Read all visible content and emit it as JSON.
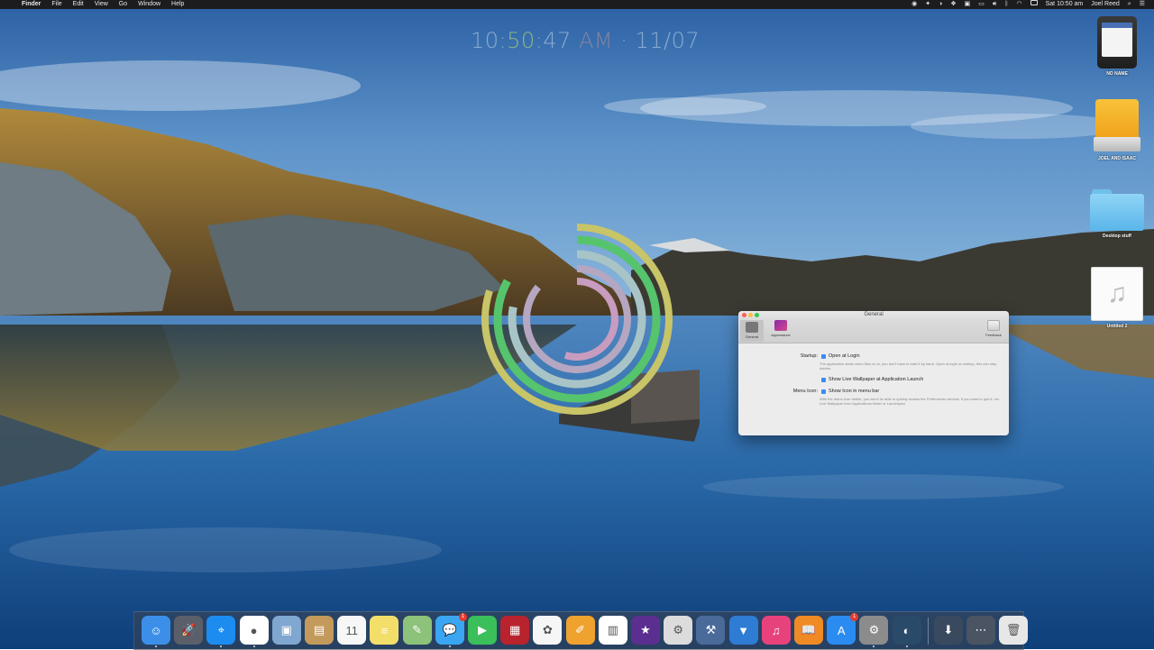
{
  "menubar": {
    "app_name": "Finder",
    "menus": [
      "File",
      "Edit",
      "View",
      "Go",
      "Window",
      "Help"
    ],
    "clock": "Sat 10:50 am",
    "user": "Joel Reed"
  },
  "clock_widget": {
    "hour": "10:",
    "minute": "50",
    "second": ":47",
    "ampm": "AM",
    "sep": " · ",
    "date": "11/07"
  },
  "desktop_icons": [
    {
      "label": "NO NAME",
      "icon": "external-disk-icon"
    },
    {
      "label": "JOEL AND ISAAC",
      "icon": "hard-drive-icon"
    },
    {
      "label": "Desktop stuff",
      "icon": "folder-icon"
    },
    {
      "label": "Untitled 2",
      "icon": "music-document-icon"
    }
  ],
  "pref_window": {
    "title": "General",
    "toolbar": [
      "General",
      "Appearance",
      "Feedback"
    ],
    "startup_label": "Startup:",
    "open_at_login": "Open at Login",
    "open_at_login_help": "The application starts when Mac is on, you don't have to start it by hand. Open at login on startup, this can stay hidden.",
    "show_live_wallpaper": "Show Live Wallpaper at Application Launch",
    "menu_icon_label": "Menu Icon:",
    "show_icon_menu_bar": "Show Icon in menu bar",
    "menu_icon_help": "With the menu icon visible, you won't be able to quickly access the Preferences window. If you want to quit it, run Live Wallpaper from Applications folder or Launchpad.",
    "checkbox_color": "#3b8bf5"
  },
  "dock": {
    "items": [
      {
        "name": "Finder",
        "icon": "finder-icon",
        "bg": "#3c8fe8",
        "glyph": "☺"
      },
      {
        "name": "Launchpad",
        "icon": "launchpad-icon",
        "bg": "#5a5f6a",
        "glyph": "🚀"
      },
      {
        "name": "Safari",
        "icon": "safari-icon",
        "bg": "#1d8cf0",
        "glyph": "⌖"
      },
      {
        "name": "Chrome",
        "icon": "chrome-icon",
        "bg": "#ffffff",
        "glyph": "●"
      },
      {
        "name": "Preview",
        "icon": "preview-icon",
        "bg": "#7fa7cf",
        "glyph": "▣"
      },
      {
        "name": "Contacts",
        "icon": "contacts-icon",
        "bg": "#c49a5c",
        "glyph": "▤"
      },
      {
        "name": "Calendar",
        "icon": "calendar-icon",
        "bg": "#f7f7f7",
        "glyph": "11"
      },
      {
        "name": "Notes",
        "icon": "notes-icon",
        "bg": "#f4de6a",
        "glyph": "≡"
      },
      {
        "name": "Maps",
        "icon": "maps-icon",
        "bg": "#8cc27a",
        "glyph": "✎"
      },
      {
        "name": "Messages",
        "icon": "messages-icon",
        "bg": "#3aa6f2",
        "glyph": "💬",
        "badge": "1"
      },
      {
        "name": "FaceTime",
        "icon": "facetime-icon",
        "bg": "#3bbf5b",
        "glyph": "▶"
      },
      {
        "name": "Photo Booth",
        "icon": "photo-booth-icon",
        "bg": "#b8232e",
        "glyph": "▦"
      },
      {
        "name": "Photos",
        "icon": "photos-icon",
        "bg": "#f6f6f6",
        "glyph": "✿"
      },
      {
        "name": "Pages",
        "icon": "pages-icon",
        "bg": "#f0a22e",
        "glyph": "✐"
      },
      {
        "name": "Numbers",
        "icon": "numbers-icon",
        "bg": "#ffffff",
        "glyph": "▥"
      },
      {
        "name": "iMovie",
        "icon": "imovie-icon",
        "bg": "#5b2f8f",
        "glyph": "★"
      },
      {
        "name": "Gatekeeper",
        "icon": "system-info-icon",
        "bg": "#dcdcdc",
        "glyph": "⚙"
      },
      {
        "name": "Xcode",
        "icon": "xcode-icon",
        "bg": "#4a6a9a",
        "glyph": "⚒"
      },
      {
        "name": "Keynote",
        "icon": "keynote-icon",
        "bg": "#2e7cd4",
        "glyph": "▼"
      },
      {
        "name": "iTunes",
        "icon": "itunes-icon",
        "bg": "#e8427c",
        "glyph": "♫"
      },
      {
        "name": "iBooks",
        "icon": "ibooks-icon",
        "bg": "#f08a24",
        "glyph": "📖"
      },
      {
        "name": "App Store",
        "icon": "app-store-icon",
        "bg": "#2a8cf0",
        "glyph": "A",
        "badge": "1"
      },
      {
        "name": "System Preferences",
        "icon": "system-preferences-icon",
        "bg": "#8c8c8c",
        "glyph": "⚙"
      },
      {
        "name": "Live Wallpaper",
        "icon": "live-wallpaper-icon",
        "bg": "#2a4a6a",
        "glyph": "◐"
      },
      {
        "name": "Downloads",
        "icon": "downloads-stack-icon",
        "bg": "#3a4a5e",
        "glyph": "⬇"
      },
      {
        "name": "Documents",
        "icon": "documents-stack-icon",
        "bg": "#4a5462",
        "glyph": "⋯"
      },
      {
        "name": "Trash",
        "icon": "trash-icon",
        "bg": "#e7e7e7",
        "glyph": "🗑"
      }
    ]
  },
  "ring_clock": {
    "rings": [
      {
        "name": "outer",
        "color": "#c8c468",
        "fraction": 0.8
      },
      {
        "name": "minutes",
        "color": "#56c46c",
        "fraction": 0.83
      },
      {
        "name": "seconds",
        "color": "#a8c4c6",
        "fraction": 0.78
      },
      {
        "name": "hours",
        "color": "#b5a6c2",
        "fraction": 0.86
      },
      {
        "name": "inner",
        "color": "#c89cbf",
        "fraction": 0.55
      }
    ]
  }
}
